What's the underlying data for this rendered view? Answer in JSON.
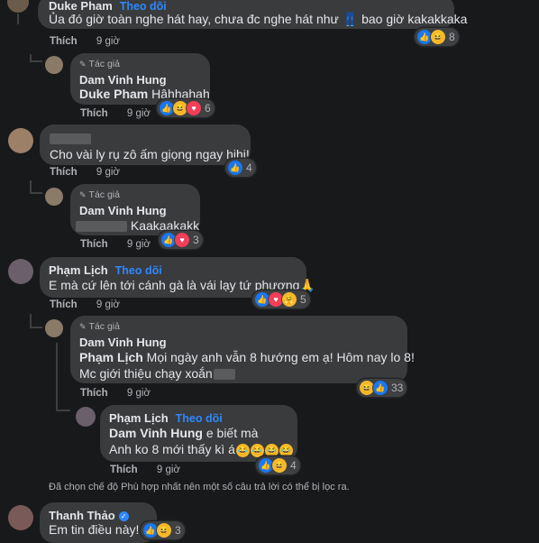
{
  "comments": {
    "c1": {
      "author": "Duke Pham",
      "follow": "Theo dõi",
      "text": "Ủa đó giờ toàn nghe hát hay, chưa đc nghe hát như 👖 bao giờ kakakkaka",
      "like": "Thích",
      "time": "9 giờ",
      "react_count": "8"
    },
    "c2": {
      "badge": "Tác giả",
      "author": "Dam Vinh Hung",
      "tag": "Duke Pham",
      "text": " Hâhhahah",
      "like": "Thích",
      "time": "9 giờ",
      "react_count": "6"
    },
    "c3": {
      "text": "Cho vài ly rụ zô ấm giọng ngay hihi!",
      "like": "Thích",
      "time": "9 giờ",
      "react_count": "4"
    },
    "c4": {
      "badge": "Tác giả",
      "author": "Dam Vinh Hung",
      "text": "Kaakaakakk",
      "like": "Thích",
      "time": "9 giờ",
      "react_count": "3"
    },
    "c5": {
      "author": "Phạm Lịch",
      "follow": "Theo dõi",
      "text": "E mà cứ lên tới cánh gà là vái lạy tứ phương🙏",
      "like": "Thích",
      "time": "9 giờ",
      "react_count": "5"
    },
    "c6": {
      "badge": "Tác giả",
      "author": "Dam Vinh Hung",
      "tag": "Phạm Lịch",
      "line1": " Mọi ngày anh vẫn 8 hướng em ạ! Hôm nay lo 8!",
      "line2": "Mc giới thiệu chạy xoắn",
      "like": "Thích",
      "time": "9 giờ",
      "react_count": "33"
    },
    "c7": {
      "author": "Phạm Lịch",
      "follow": "Theo dõi",
      "tag": "Dam Vinh Hung",
      "line1": " e biết mà",
      "line2": "Anh ko 8 mới thấy kì á",
      "like": "Thích",
      "time": "9 giờ",
      "react_count": "4"
    },
    "notice": "Đã chọn chế độ Phù hợp nhất nên một số câu trả lời có thể bị lọc ra.",
    "c8": {
      "author": "Thanh Thảo",
      "text": "Em tin điều này!",
      "react_count": "3"
    }
  },
  "colors": {
    "background": "#18191a",
    "bubble": "#3a3b3c",
    "link": "#2d88ff",
    "like_blue": "#1877f2",
    "haha_yellow": "#f7b928",
    "love_red": "#f33e58"
  }
}
